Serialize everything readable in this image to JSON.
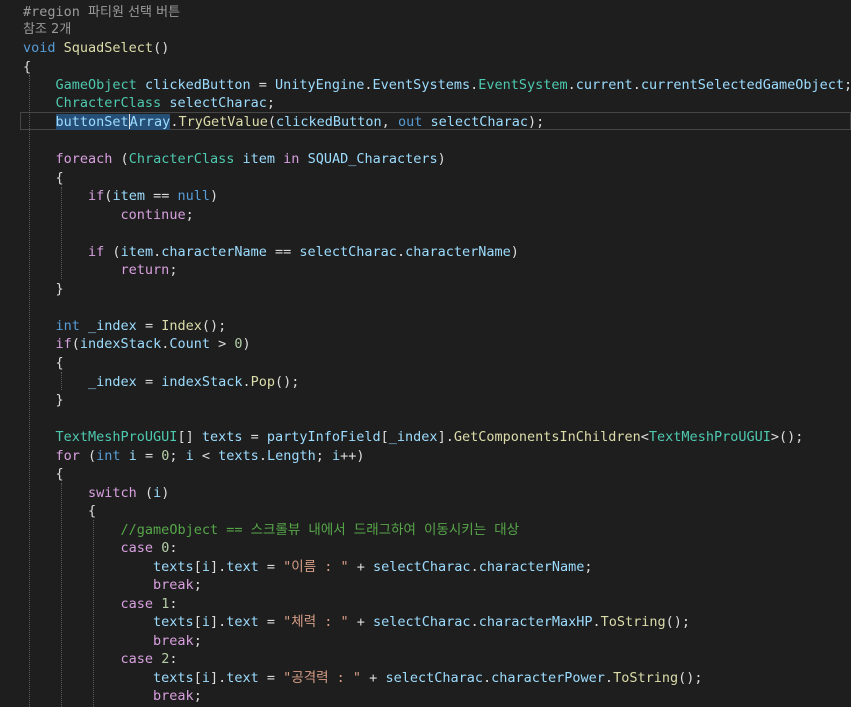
{
  "editor": {
    "region_directive": "#region",
    "region_name": "파티원 선택 버튼",
    "reference_count": "참조 2개",
    "code": {
      "void_kw": "void",
      "method_name": "SquadSelect",
      "gameobject_type": "GameObject",
      "clicked_button": "clickedButton",
      "unity_engine": "UnityEngine",
      "event_systems": "EventSystems",
      "event_system": "EventSystem",
      "current": "current",
      "current_selected": "currentSelectedGameObject",
      "chracter_class": "ChracterClass",
      "select_charac": "selectCharac",
      "button_set_prefix": "buttonSet",
      "button_set_selected": "Array",
      "try_get_value": "TryGetValue",
      "out_kw": "out",
      "foreach_kw": "foreach",
      "item": "item",
      "in_kw": "in",
      "squad_characters": "SQUAD_Characters",
      "if_kw": "if",
      "null_kw": "null",
      "continue_kw": "continue",
      "character_name": "characterName",
      "return_kw": "return",
      "int_kw": "int",
      "index_var": "_index",
      "index_fn": "Index",
      "index_stack": "indexStack",
      "count": "Count",
      "zero": "0",
      "pop": "Pop",
      "tmp_ugui": "TextMeshProUGUI",
      "texts": "texts",
      "party_info_field": "partyInfoField",
      "get_components": "GetComponentsInChildren",
      "for_kw": "for",
      "i_var": "i",
      "length": "Length",
      "switch_kw": "switch",
      "comment_line": "//gameObject == 스크롤뷰 내에서 드래그하여 이동시키는 대상",
      "case_kw": "case",
      "n1": "1",
      "n2": "2",
      "text_prop": "text",
      "str_name": "\"이름 : \"",
      "str_hp": "\"체력 : \"",
      "str_power": "\"공격력 : \"",
      "character_max_hp": "characterMaxHP",
      "to_string": "ToString",
      "character_power": "characterPower",
      "break_kw": "break"
    }
  }
}
